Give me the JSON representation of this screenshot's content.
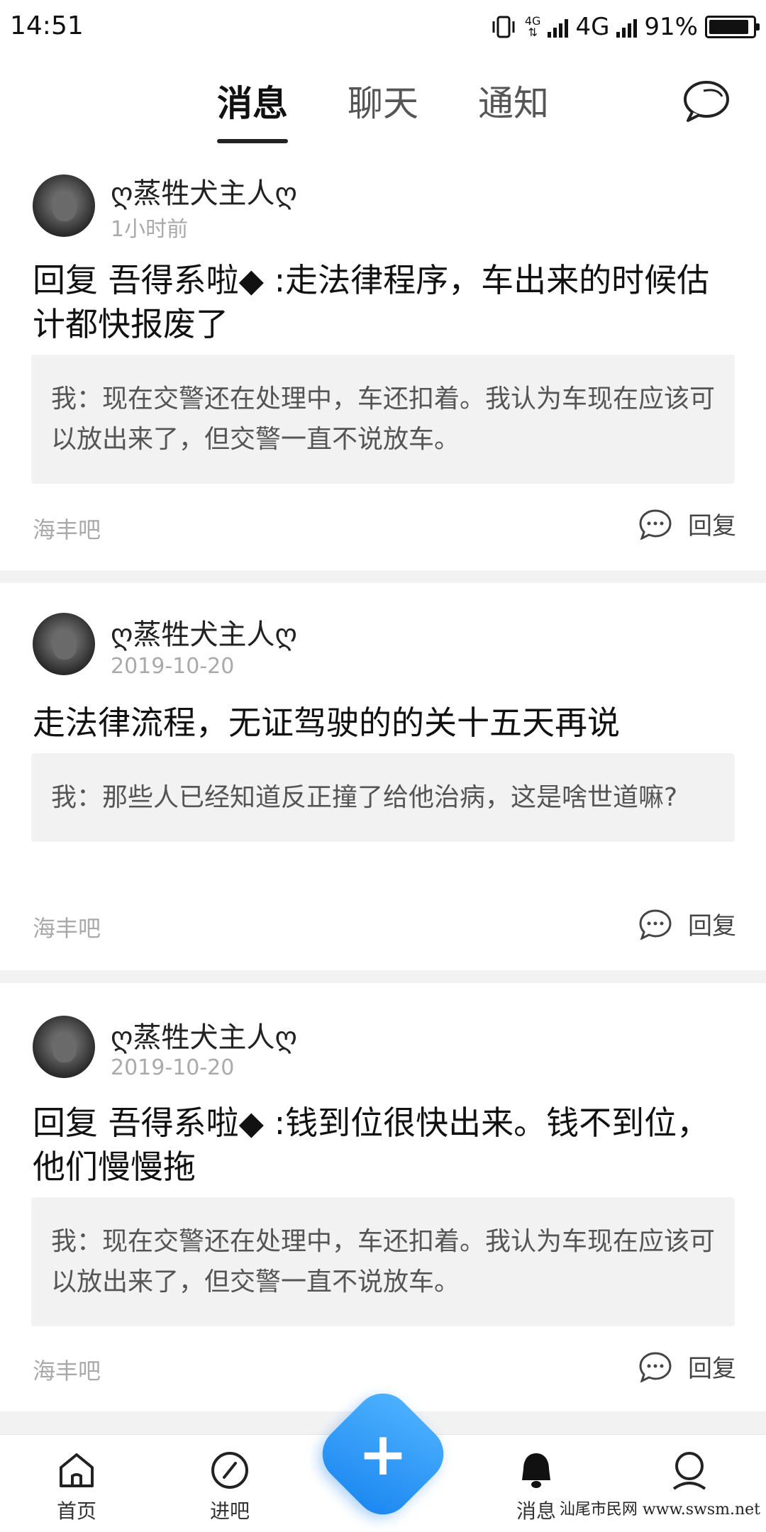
{
  "status_bar": {
    "time": "14:51",
    "network_small": "4G",
    "network": "4G",
    "battery": "91%",
    "battery_level": 0.91
  },
  "tabs": [
    {
      "label": "消息",
      "active": true
    },
    {
      "label": "聊天",
      "active": false
    },
    {
      "label": "通知",
      "active": false
    }
  ],
  "posts": [
    {
      "username": "ღ蒸牲犬主人ღ",
      "time": "1小时前",
      "content": "回复 吾得系啦◆ :走法律程序，车出来的时候估计都快报废了",
      "quote": "我：现在交警还在处理中，车还扣着。我认为车现在应该可以放出来了，但交警一直不说放车。",
      "forum": "海丰吧",
      "reply_label": "回复"
    },
    {
      "username": "ღ蒸牲犬主人ღ",
      "time": "2019-10-20",
      "content": "走法律流程，无证驾驶的的关十五天再说",
      "quote": "我：那些人已经知道反正撞了给他治病，这是啥世道嘛?",
      "forum": "海丰吧",
      "reply_label": "回复"
    },
    {
      "username": "ღ蒸牲犬主人ღ",
      "time": "2019-10-20",
      "content": "回复 吾得系啦◆ :钱到位很快出来。钱不到位，他们慢慢拖",
      "quote": "我：现在交警还在处理中，车还扣着。我认为车现在应该可以放出来了，但交警一直不说放车。",
      "forum": "海丰吧",
      "reply_label": "回复"
    }
  ],
  "bottom_nav": [
    {
      "label": "首页",
      "icon": "home-icon"
    },
    {
      "label": "进吧",
      "icon": "compass-icon"
    },
    {
      "label": "",
      "icon": "plus-icon"
    },
    {
      "label": "消息",
      "icon": "bell-icon"
    },
    {
      "label": "",
      "icon": "profile-icon"
    }
  ],
  "watermark": "汕尾市民网 www.swsm.net"
}
